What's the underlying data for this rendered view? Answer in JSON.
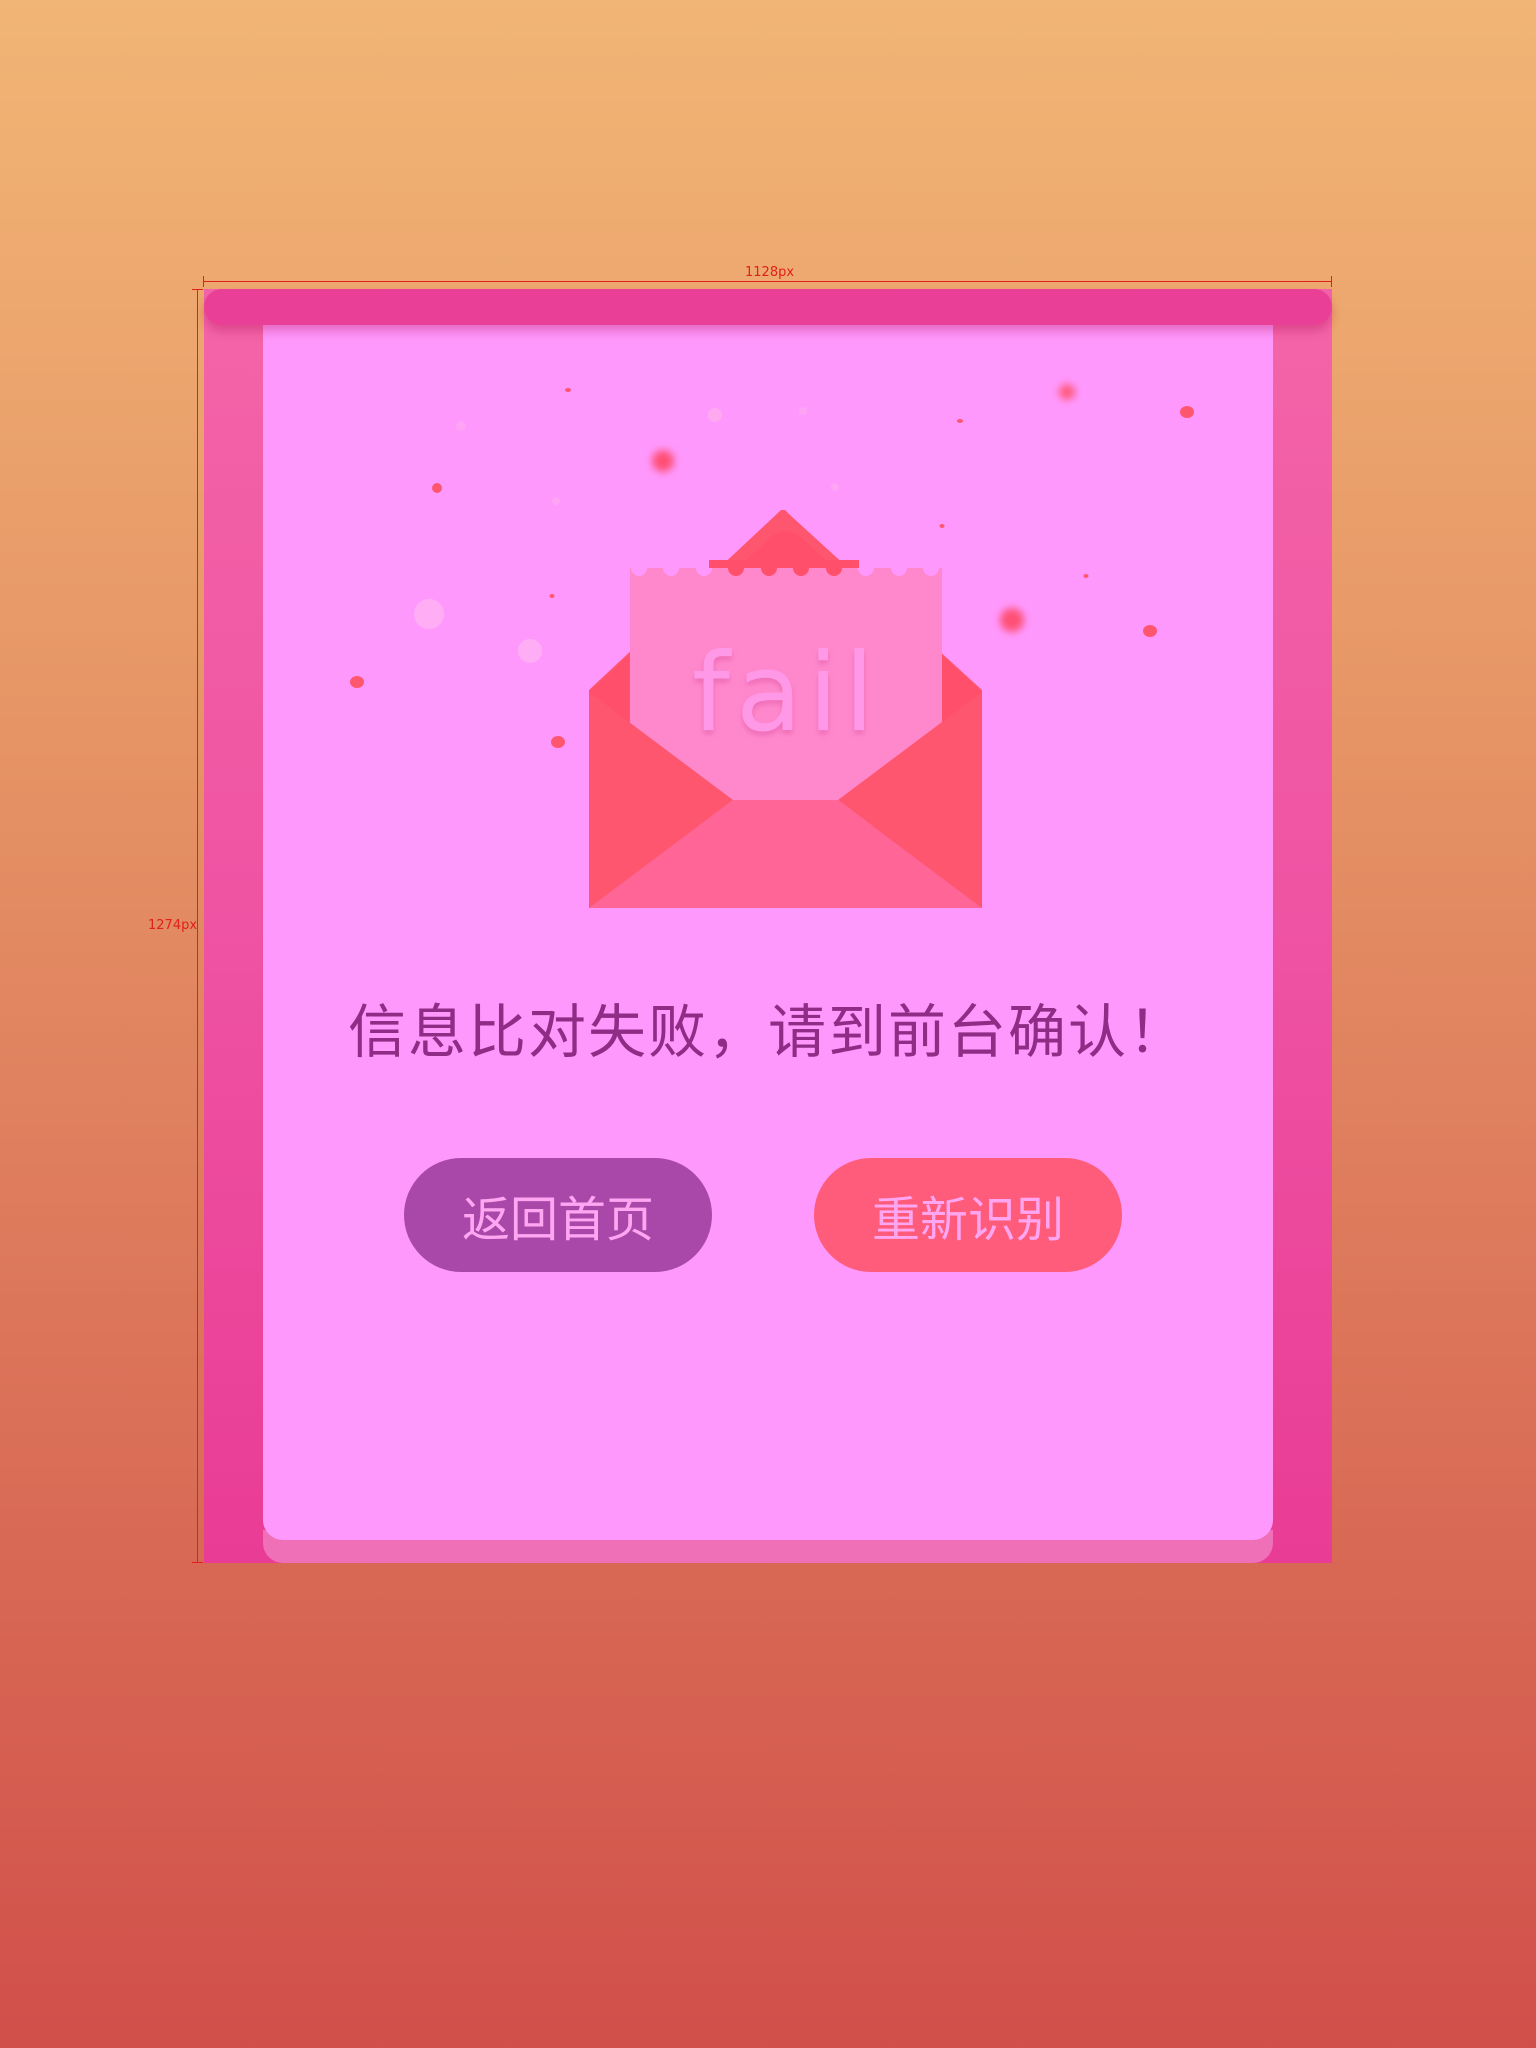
{
  "annotations": {
    "width_label": "1128px",
    "height_label": "1274px"
  },
  "dialog": {
    "card_text": "fail",
    "message": "信息比对失败，请到前台确认！",
    "buttons": {
      "home_label": "返回首页",
      "retry_label": "重新识别"
    }
  },
  "colors": {
    "background_top": "#f1b575",
    "background_bottom": "#d14f4a",
    "frame": "#ef53a3",
    "panel": "#ff98fd",
    "envelope": "#ff5670",
    "message_text": "#8e2c86",
    "home_button": "#a948a8",
    "retry_button": "#ff5b7a"
  },
  "icons": [
    "envelope-icon",
    "fail-card-icon"
  ]
}
